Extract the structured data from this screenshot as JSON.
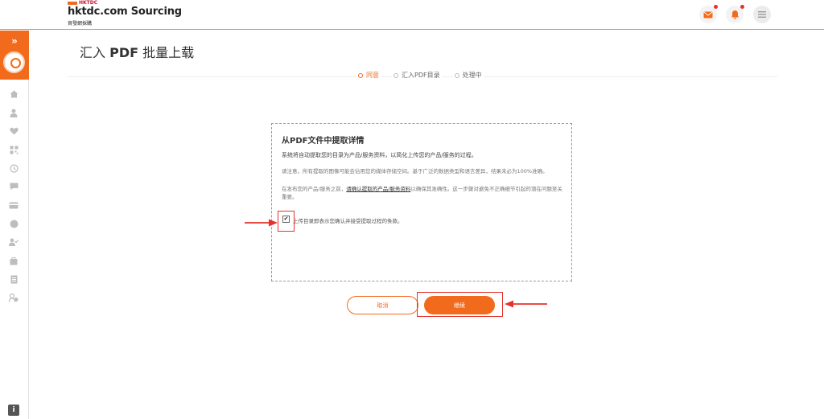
{
  "header": {
    "logo_tag": "HKTDC",
    "logo_main": "hktdc.com Sourcing",
    "logo_sub": "貿發網採購",
    "icons": [
      "mail-icon",
      "bell-icon",
      "menu-icon"
    ]
  },
  "sidebar": {
    "expand_glyph": "»",
    "info_glyph": "i",
    "icons": [
      "home-icon",
      "user-icon",
      "heart-icon",
      "qr-icon",
      "history-icon",
      "chat-icon",
      "card-icon",
      "box-icon",
      "user-check-icon",
      "bag-icon",
      "document-icon",
      "people-icon"
    ]
  },
  "page": {
    "title_prefix": "汇入 ",
    "title_bold": "PDF",
    "title_suffix": " 批量上载"
  },
  "steps": [
    {
      "label": "同意",
      "active": true
    },
    {
      "label": "汇入PDF目录",
      "active": false
    },
    {
      "label": "处理中",
      "active": false
    }
  ],
  "dialog": {
    "title": "从PDF文件中提取详情",
    "desc": "系统将自动提取您的目录为产品/服务资料，以简化上传您的产品/服务的过程。",
    "note1": "请注意，所有提取的图像可能会佔用您的媒体存储空间。基于广泛的数据类型和语言差异，结果未必为100%准确。",
    "note2_pre": "在发布您的产品/服务之前，",
    "note2_link": "请确认提取的产品/服务资料",
    "note2_post": "以确保其准确性。这一步骤对避免不正确细节引起的潜在问题至关重要。",
    "check_mark": "✔",
    "check_label": "上传目录即表示您确认并接受提取过程的条款。"
  },
  "buttons": {
    "cancel": "取消",
    "continue": "继续"
  },
  "colors": {
    "accent": "#f26b1d",
    "annotation": "#e5322d"
  }
}
